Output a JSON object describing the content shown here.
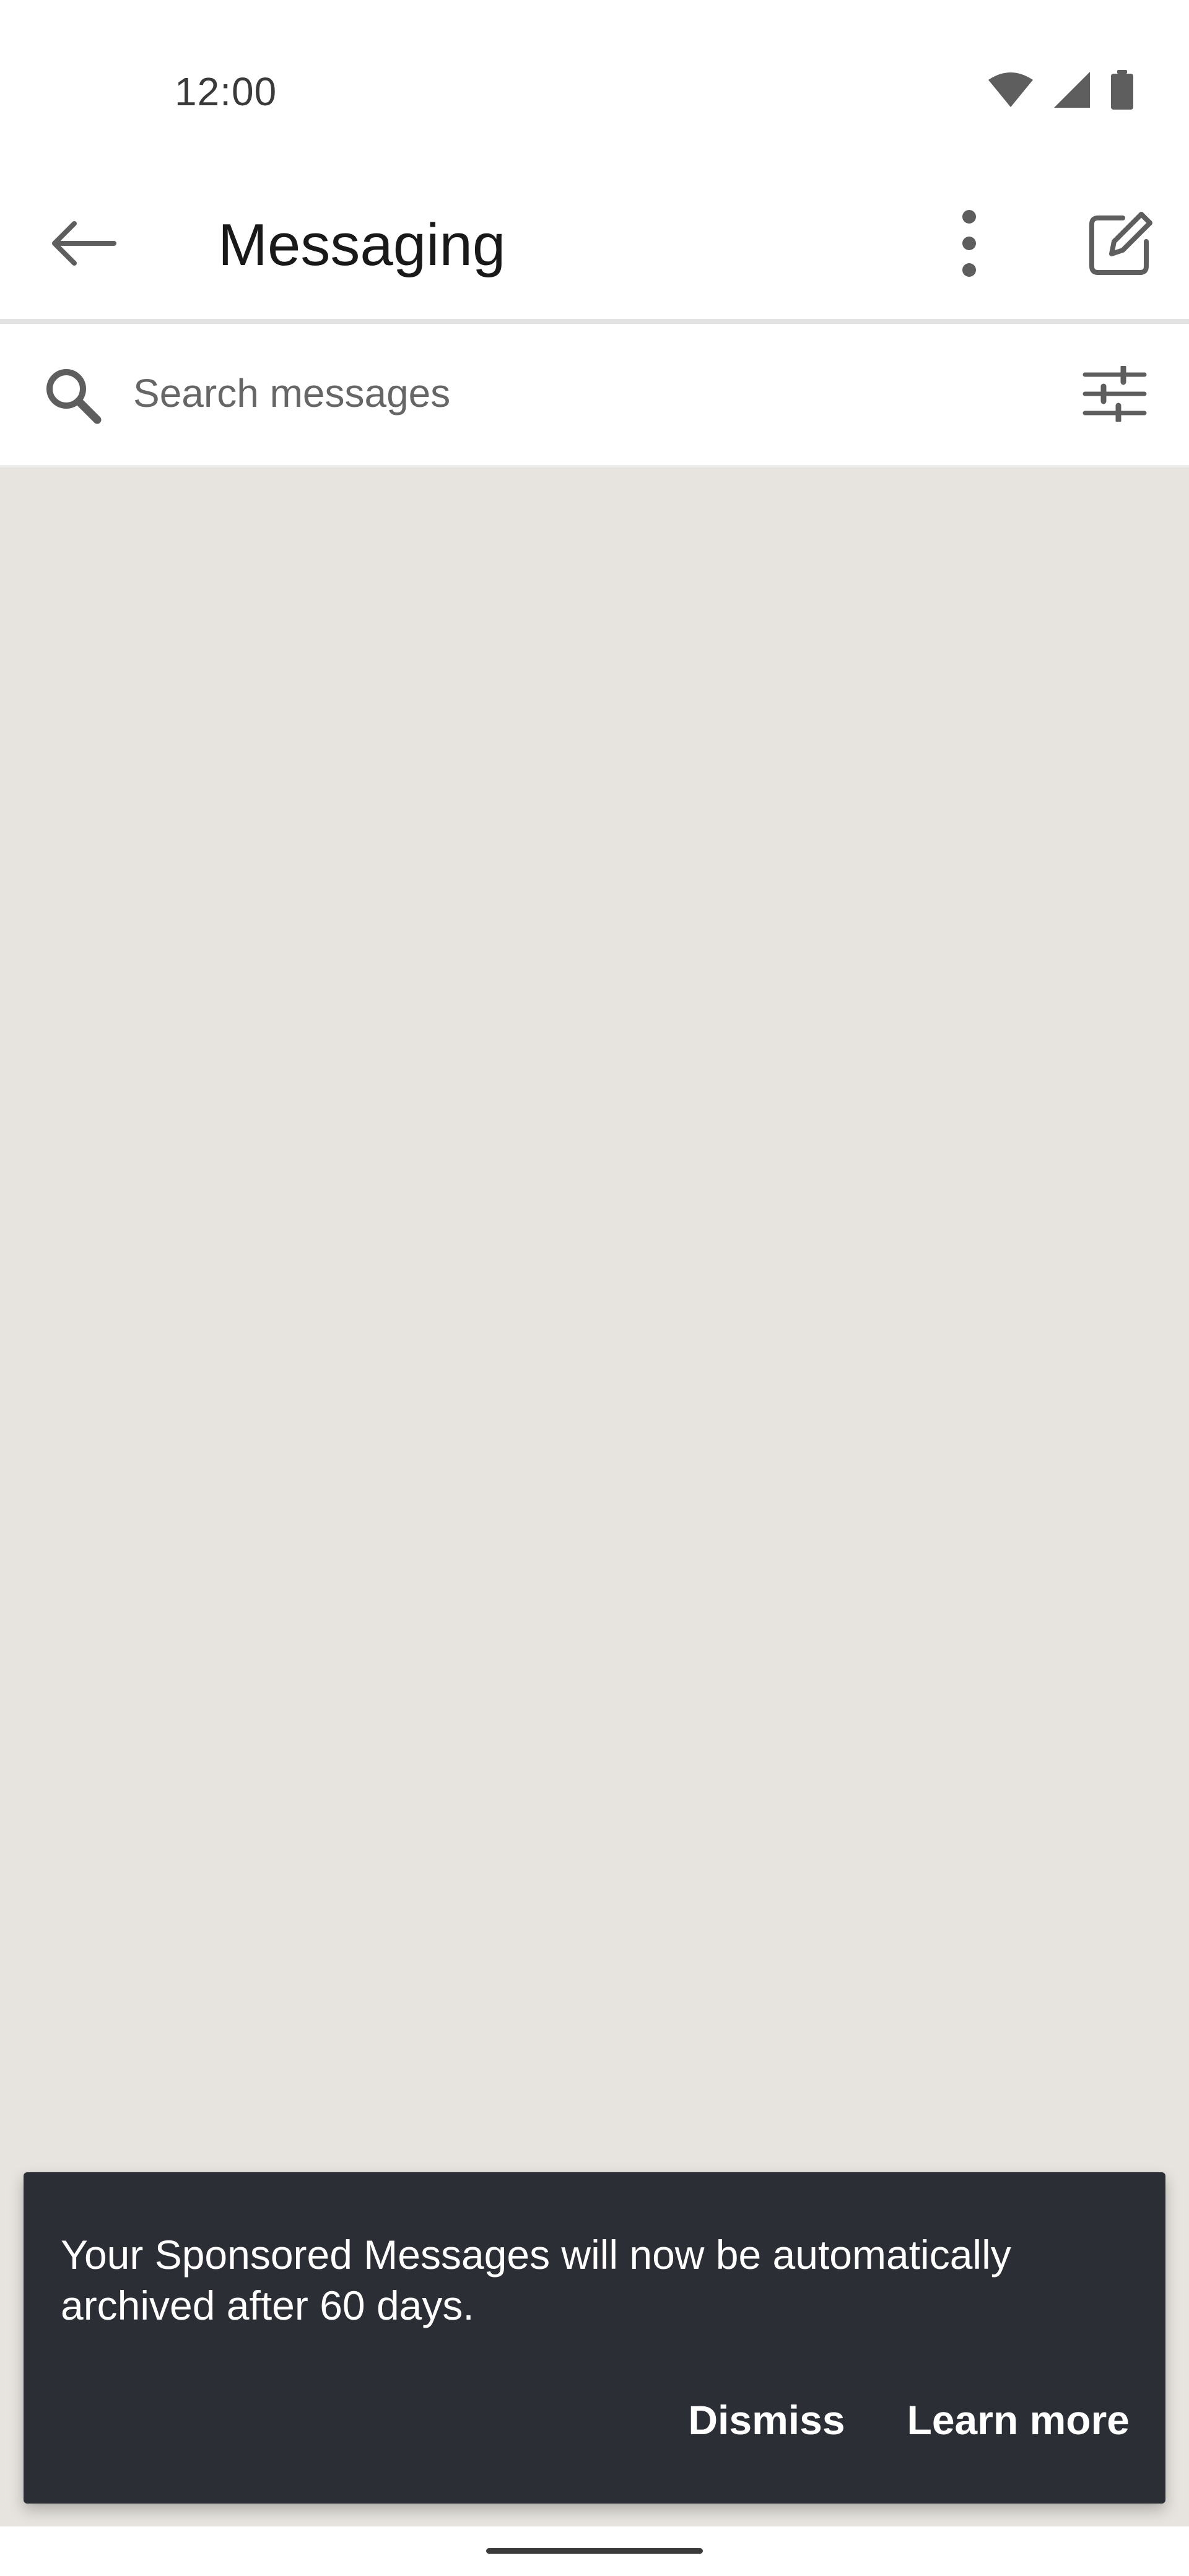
{
  "status_bar": {
    "time": "12:00",
    "icons": [
      "wifi-icon",
      "cellular-signal-icon",
      "battery-icon"
    ]
  },
  "app_bar": {
    "title": "Messaging",
    "icons": [
      "back-arrow-icon",
      "more-vertical-icon",
      "compose-icon"
    ]
  },
  "search": {
    "placeholder": "Search messages",
    "value": "",
    "icons": [
      "search-icon",
      "filter-sliders-icon"
    ]
  },
  "snackbar": {
    "message": "Your Sponsored Messages will now be automatically archived after 60 days.",
    "dismiss_label": "Dismiss",
    "learn_more_label": "Learn more"
  },
  "colors": {
    "content_background": "#e7e4df",
    "snackbar_background": "#2b2f35",
    "text_primary": "#191919",
    "icon_gray": "#5e5e5e"
  }
}
